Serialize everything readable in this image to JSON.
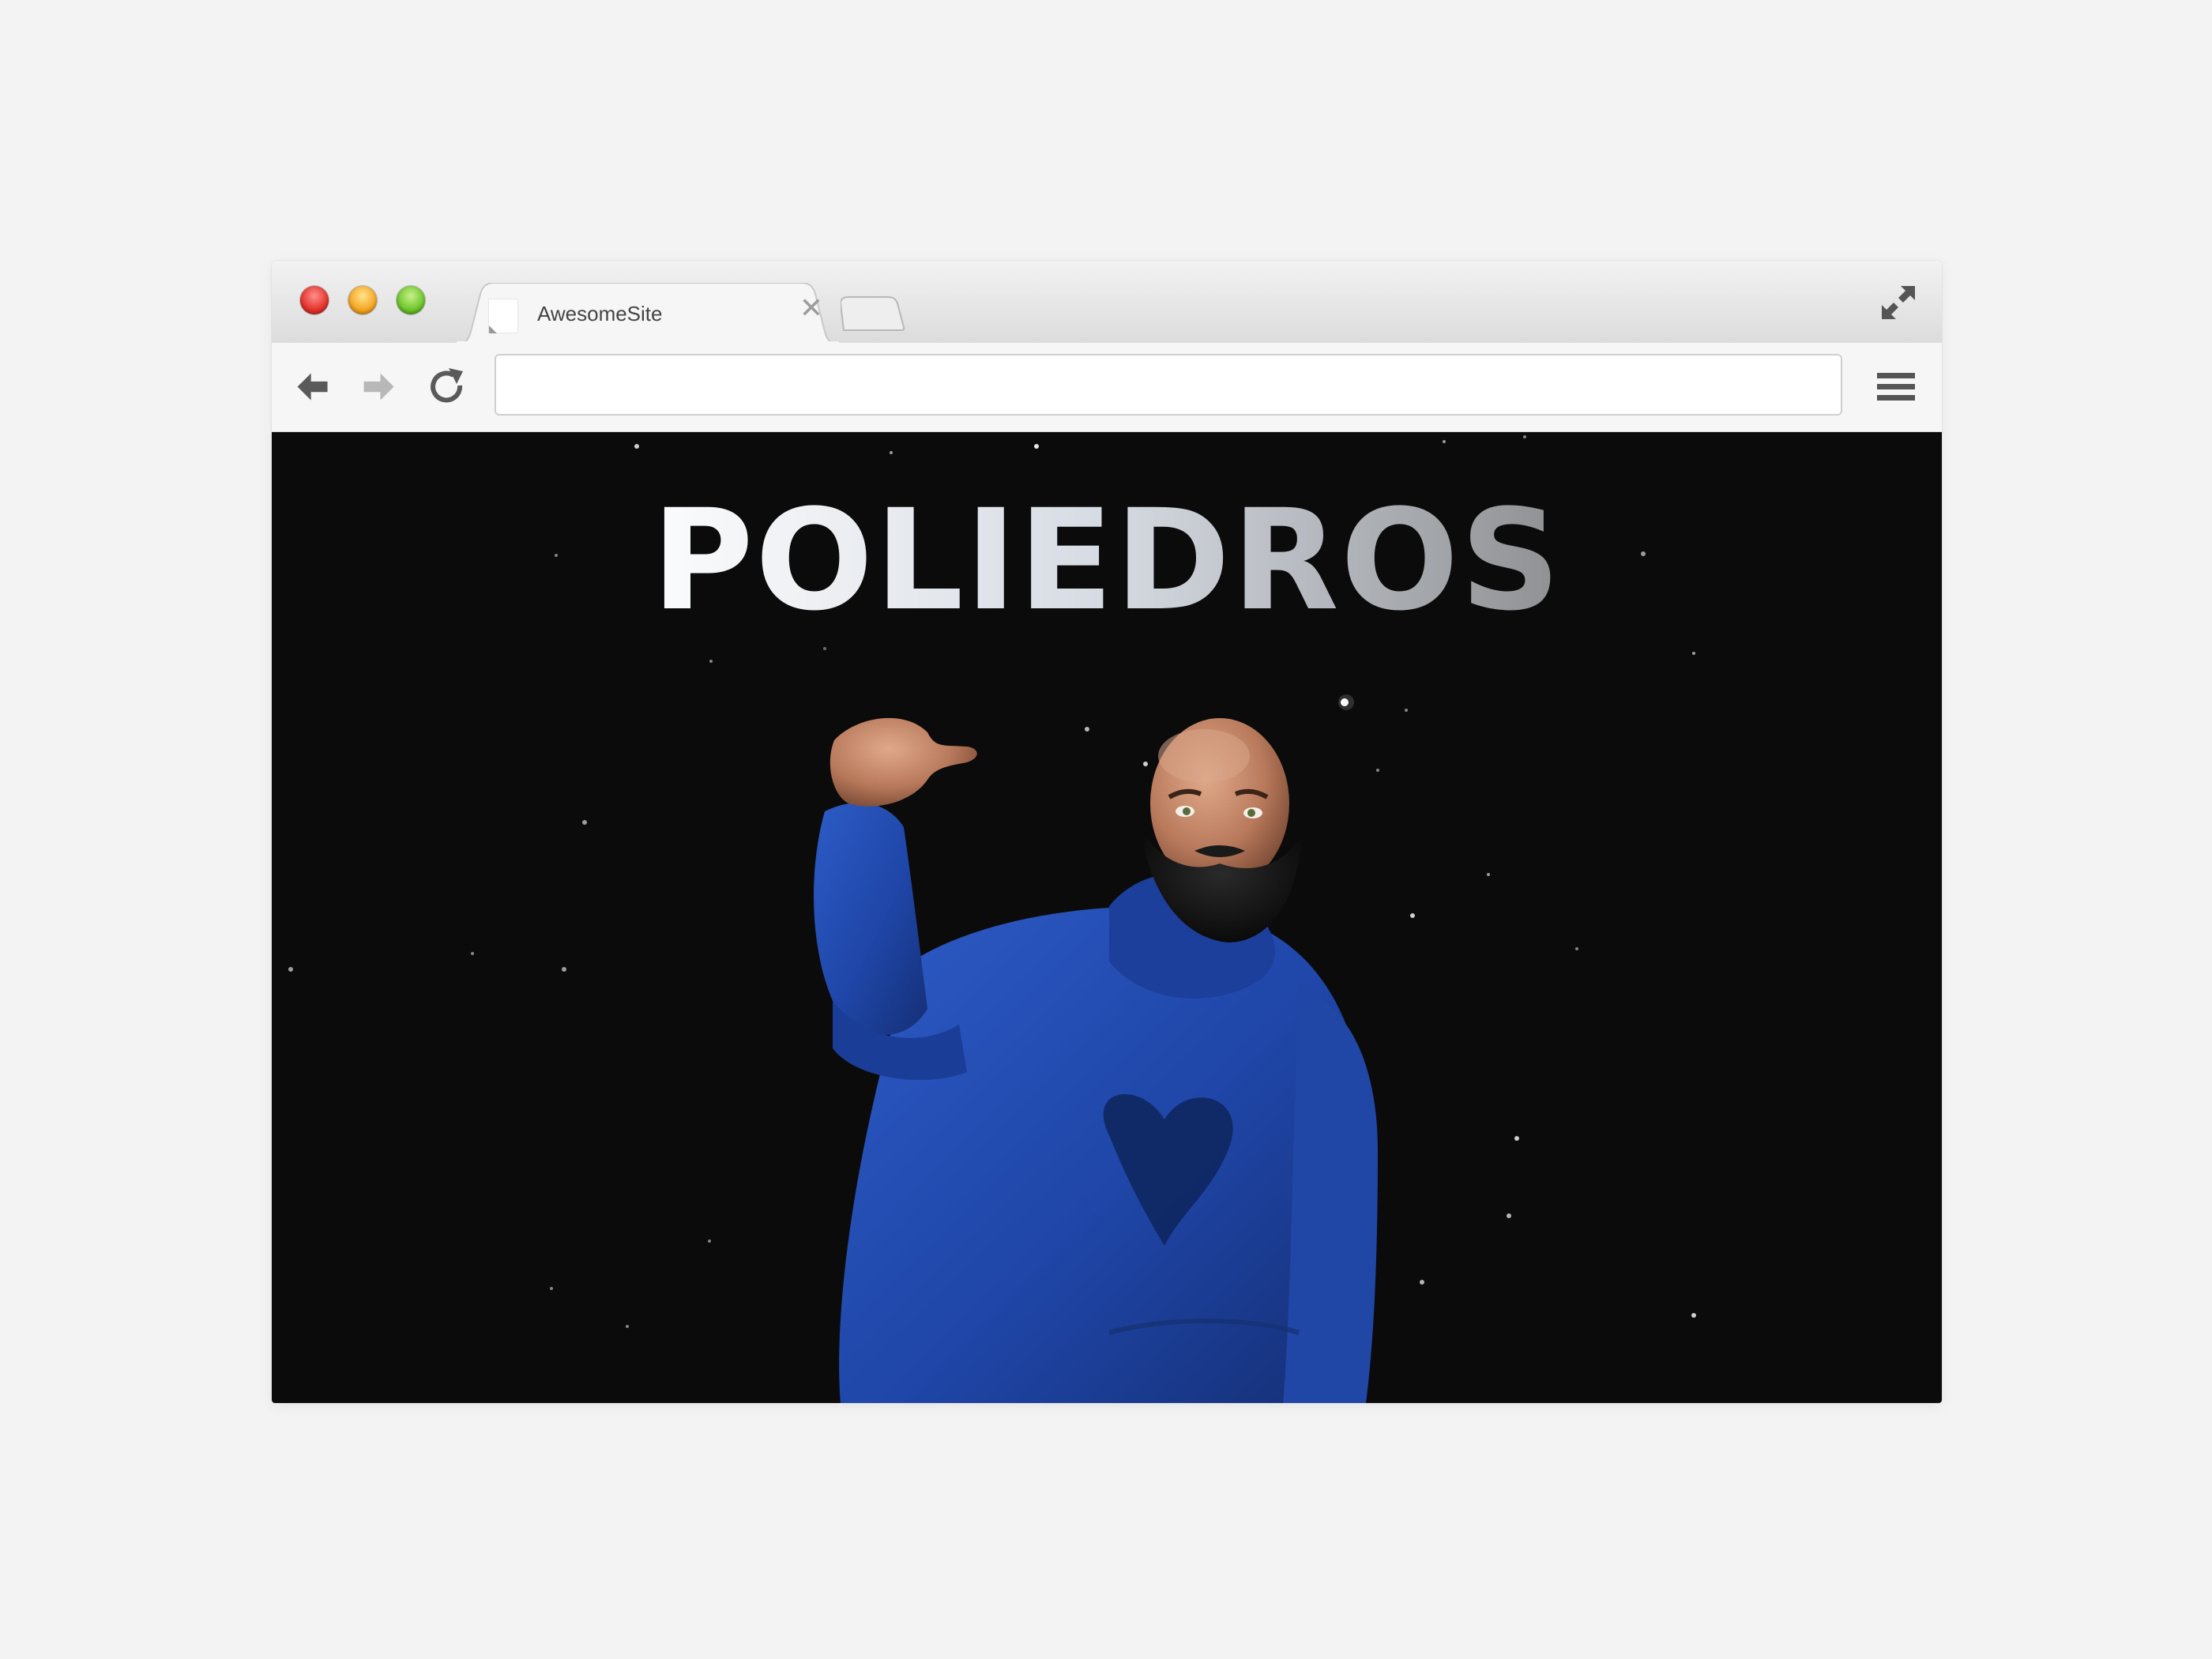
{
  "browser": {
    "tab": {
      "title": "AwesomeSite",
      "close_glyph": "✕"
    },
    "address_bar": {
      "value": "",
      "placeholder": ""
    },
    "icons": {
      "back": "arrow-left-icon",
      "forward": "arrow-right-icon",
      "reload": "reload-icon",
      "menu": "hamburger-menu-icon",
      "fullscreen": "expand-icon"
    },
    "traffic_lights": [
      "#e2322a",
      "#f5a623",
      "#6cc62a"
    ]
  },
  "page": {
    "headline": "POLIEDROS",
    "background_color": "#0b0b0b",
    "hero_image": "3d-avatar-man-bald-beard-blue-hoodie-thumb-pointing",
    "hoodie_color": "#1f46a8"
  }
}
